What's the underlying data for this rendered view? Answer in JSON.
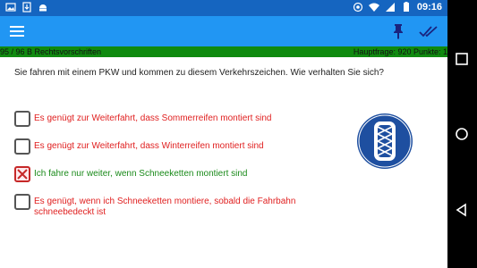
{
  "status": {
    "time": "09:16"
  },
  "info": {
    "left": "95 / 96  B   Rechtsvorschriften",
    "right": "Hauptfrage: 920  Punkte: 1"
  },
  "question": "Sie fahren mit einem PKW und kommen zu diesem Verkehrszeichen. Wie verhalten Sie sich?",
  "answers": [
    {
      "text": "Es genügt zur Weiterfahrt, dass Sommerreifen montiert sind",
      "checked": false
    },
    {
      "text": "Es genügt zur Weiterfahrt, dass Winterreifen montiert sind",
      "checked": false
    },
    {
      "text": "Ich fahre nur weiter, wenn Schneeketten montiert sind",
      "checked": true
    },
    {
      "text": "Es genügt, wenn ich Schneeketten montiere, sobald die Fahrbahn schneebedeckt ist",
      "checked": false
    }
  ],
  "colors": {
    "appbar": "#2196f3",
    "statusbar": "#1565c0",
    "infobar": "#0f8a0f",
    "wrong": "#e02020",
    "right": "#1a8a1a",
    "sign_blue": "#1e4fa0"
  },
  "icons": [
    "menu-icon",
    "pin-icon",
    "double-check-icon",
    "wifi-icon",
    "battery-icon",
    "back-icon",
    "home-icon",
    "recents-icon"
  ]
}
